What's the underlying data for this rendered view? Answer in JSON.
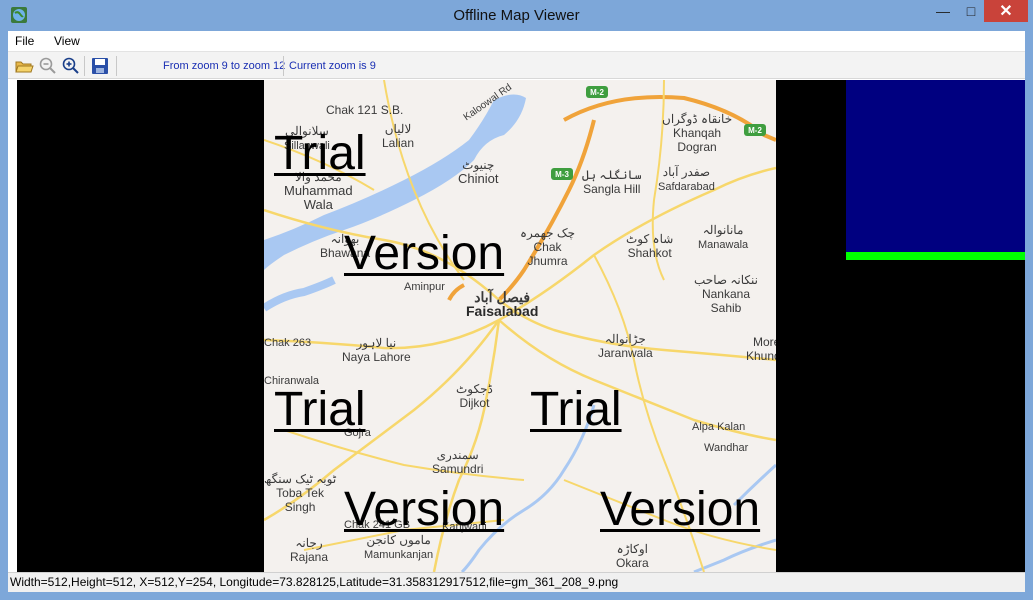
{
  "window": {
    "title": "Offline Map Viewer",
    "min_glyph": "—",
    "max_glyph": "□",
    "close_glyph": "✕"
  },
  "menu": {
    "file": "File",
    "view": "View"
  },
  "toolbar": {
    "zoom_range": "From zoom 9 to zoom 12",
    "zoom_current": "Current zoom is 9",
    "icons": [
      "folder-open-icon",
      "zoom-out-icon",
      "zoom-in-icon",
      "save-icon"
    ]
  },
  "map": {
    "places": [
      {
        "id": "chak121",
        "name": "Chak 121 S.B.",
        "urdu": ""
      },
      {
        "id": "lalian",
        "name": "Lalian",
        "urdu": "لالیاں"
      },
      {
        "id": "chiniot",
        "name": "Chiniot",
        "urdu": "چنیوٹ"
      },
      {
        "id": "muhammadwala",
        "name": "Muhammad\nWala",
        "urdu": "محمد والا"
      },
      {
        "id": "khanqah",
        "name": "Khanqah\nDogran",
        "urdu": "خانقاہ ڈوگراں"
      },
      {
        "id": "sanglahill",
        "name": "Sangla Hill",
        "urdu": "سانگلہ ہل"
      },
      {
        "id": "safdarabad",
        "name": "Safdarabad",
        "urdu": "صفدر آباد"
      },
      {
        "id": "bhawana",
        "name": "Bhawana",
        "urdu": "بھوانہ"
      },
      {
        "id": "chakjhumra",
        "name": "Chak\nJhumra",
        "urdu": "چک جھمرہ"
      },
      {
        "id": "shahkot",
        "name": "Shahkot",
        "urdu": "شاہ کوٹ"
      },
      {
        "id": "manawala",
        "name": "Manawala",
        "urdu": "مانانوالہ"
      },
      {
        "id": "aminpur",
        "name": "Aminpur",
        "urdu": ""
      },
      {
        "id": "faisalabad",
        "name": "Faisalabad",
        "urdu": "فیصل آباد"
      },
      {
        "id": "nankana",
        "name": "Nankana\nSahib",
        "urdu": "ننکانہ صاحب"
      },
      {
        "id": "jaranwala",
        "name": "Jaranwala",
        "urdu": "جڑانوالہ"
      },
      {
        "id": "nayalahore",
        "name": "Naya Lahore",
        "urdu": "نیا لاہور"
      },
      {
        "id": "dijkot",
        "name": "Dijkot",
        "urdu": "ڈجکوٹ"
      },
      {
        "id": "alpakalan",
        "name": "Alpa Kalan",
        "urdu": ""
      },
      {
        "id": "wandhar",
        "name": "Wandhar",
        "urdu": ""
      },
      {
        "id": "samundri",
        "name": "Samundri",
        "urdu": "سمندری"
      },
      {
        "id": "tobatek",
        "name": "Toba Tek\nSingh",
        "urdu": "ٹوبہ ٹیک سنگھ"
      },
      {
        "id": "mamunkanjan",
        "name": "Mamunkanjan",
        "urdu": "ماموں کانجن"
      },
      {
        "id": "okara",
        "name": "Okara",
        "urdu": "اوکاڑہ"
      },
      {
        "id": "rajana",
        "name": "Rajana",
        "urdu": "رجانہ"
      },
      {
        "id": "kanjwani",
        "name": "Kanjwani",
        "urdu": ""
      },
      {
        "id": "chak241",
        "name": "Chak 241 GB",
        "urdu": ""
      },
      {
        "id": "gojra",
        "name": "Gojra",
        "urdu": ""
      },
      {
        "id": "chak263",
        "name": "Chak 263",
        "urdu": ""
      },
      {
        "id": "chiranwala",
        "name": "Chiranwala",
        "urdu": ""
      },
      {
        "id": "silanwali",
        "name": "Sillanwali",
        "urdu": "سلانوالی"
      },
      {
        "id": "more",
        "name": "More\nKhunda",
        "urdu": ""
      },
      {
        "id": "kalowal",
        "name": "Kaloowal Rd",
        "urdu": ""
      }
    ],
    "shields": [
      "M-2",
      "M-3",
      "M-2"
    ],
    "watermarks": [
      "Trial",
      "Version",
      "Trial",
      "Trial",
      "Version",
      "Version"
    ]
  },
  "status": {
    "text": "Width=512,Height=512, X=512,Y=254, Longitude=73.828125,Latitude=31.358312917512,file=gm_361_208_9.png"
  },
  "colors": {
    "titlebar": "#7da7d9",
    "blue_panel": "#000080",
    "green_bar": "#00ff00",
    "close": "#c9433a"
  }
}
